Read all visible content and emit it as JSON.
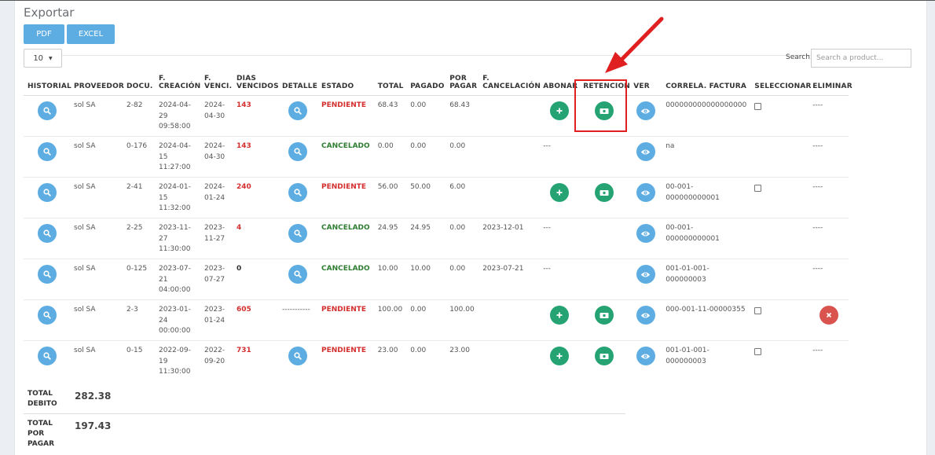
{
  "page": {
    "title": "Exportar",
    "export_buttons": [
      "PDF",
      "EXCEL"
    ],
    "page_length": "10",
    "search_label": "Search:",
    "search_placeholder": "Search a product..."
  },
  "table": {
    "columns": [
      "HISTORIAL",
      "PROVEEDOR",
      "DOCU.",
      "F. CREACIÓN",
      "F. VENCI.",
      "DIAS VENCIDOS",
      "DETALLE",
      "ESTADO",
      "TOTAL",
      "PAGADO",
      "POR PAGAR",
      "F. CANCELACIÓN",
      "ABONAR",
      "RETENCION",
      "VER",
      "CORRELA. FACTURA",
      "SELECCIONAR",
      "ELIMINAR"
    ],
    "rows": [
      {
        "proveedor": "sol SA",
        "docu": "2-82",
        "f_creacion": "2024-04-29 09:58:00",
        "f_venci": "2024-04-30",
        "dias": "143",
        "detalle": "button",
        "estado": "PENDIENTE",
        "total": "68.43",
        "pagado": "0.00",
        "por_pagar": "68.43",
        "f_cancelacion": "",
        "abonar": "button",
        "retencion": "button",
        "correla": "000000000000000000",
        "seleccionar": "checkbox",
        "eliminar": "----"
      },
      {
        "proveedor": "sol SA",
        "docu": "0-176",
        "f_creacion": "2024-04-15 11:27:00",
        "f_venci": "2024-04-30",
        "dias": "143",
        "detalle": "button",
        "estado": "CANCELADO",
        "total": "0.00",
        "pagado": "0.00",
        "por_pagar": "0.00",
        "f_cancelacion": "",
        "abonar": "---",
        "retencion": "",
        "correla": "na",
        "seleccionar": "",
        "eliminar": "----"
      },
      {
        "proveedor": "sol SA",
        "docu": "2-41",
        "f_creacion": "2024-01-15 11:32:00",
        "f_venci": "2024-01-24",
        "dias": "240",
        "detalle": "button",
        "estado": "PENDIENTE",
        "total": "56.00",
        "pagado": "50.00",
        "por_pagar": "6.00",
        "f_cancelacion": "",
        "abonar": "button",
        "retencion": "button",
        "correla": "00-001-000000000001",
        "seleccionar": "checkbox",
        "eliminar": "----"
      },
      {
        "proveedor": "sol SA",
        "docu": "2-25",
        "f_creacion": "2023-11-27 11:30:00",
        "f_venci": "2023-11-27",
        "dias": "4",
        "detalle": "button",
        "estado": "CANCELADO",
        "total": "24.95",
        "pagado": "24.95",
        "por_pagar": "0.00",
        "f_cancelacion": "2023-12-01",
        "abonar": "---",
        "retencion": "",
        "correla": "00-001-000000000001",
        "seleccionar": "",
        "eliminar": "----"
      },
      {
        "proveedor": "sol SA",
        "docu": "0-125",
        "f_creacion": "2023-07-21 04:00:00",
        "f_venci": "2023-07-27",
        "dias": "0",
        "detalle": "button",
        "estado": "CANCELADO",
        "total": "10.00",
        "pagado": "10.00",
        "por_pagar": "0.00",
        "f_cancelacion": "2023-07-21",
        "abonar": "---",
        "retencion": "",
        "correla": "001-01-001-000000003",
        "seleccionar": "",
        "eliminar": "----"
      },
      {
        "proveedor": "sol SA",
        "docu": "2-3",
        "f_creacion": "2023-01-24 00:00:00",
        "f_venci": "2023-01-24",
        "dias": "605",
        "detalle": "-----------",
        "estado": "PENDIENTE",
        "total": "100.00",
        "pagado": "0.00",
        "por_pagar": "100.00",
        "f_cancelacion": "",
        "abonar": "button",
        "retencion": "button",
        "correla": "000-001-11-00000355",
        "seleccionar": "checkbox",
        "eliminar": "button"
      },
      {
        "proveedor": "sol SA",
        "docu": "0-15",
        "f_creacion": "2022-09-19 11:30:00",
        "f_venci": "2022-09-20",
        "dias": "731",
        "detalle": "button",
        "estado": "PENDIENTE",
        "total": "23.00",
        "pagado": "0.00",
        "por_pagar": "23.00",
        "f_cancelacion": "",
        "abonar": "button",
        "retencion": "button",
        "correla": "001-01-001-000000003",
        "seleccionar": "checkbox",
        "eliminar": "----"
      }
    ]
  },
  "totals": {
    "debito_label": "TOTAL DEBITO",
    "debito_value": "282.38",
    "por_pagar_label": "TOTAL POR PAGAR",
    "por_pagar_value": "197.43"
  },
  "colors": {
    "pendiente": "#d32f2f",
    "cancelado": "#2e7d32",
    "info_button": "#5dade2",
    "success_button": "#26a373",
    "danger_button": "#d9534f",
    "annotation": "#e02020"
  },
  "icons": {
    "historial": "search-icon",
    "detalle": "search-icon",
    "abonar": "plus-icon",
    "retencion": "money-bill-icon",
    "ver": "eye-icon",
    "eliminar": "close-icon"
  }
}
